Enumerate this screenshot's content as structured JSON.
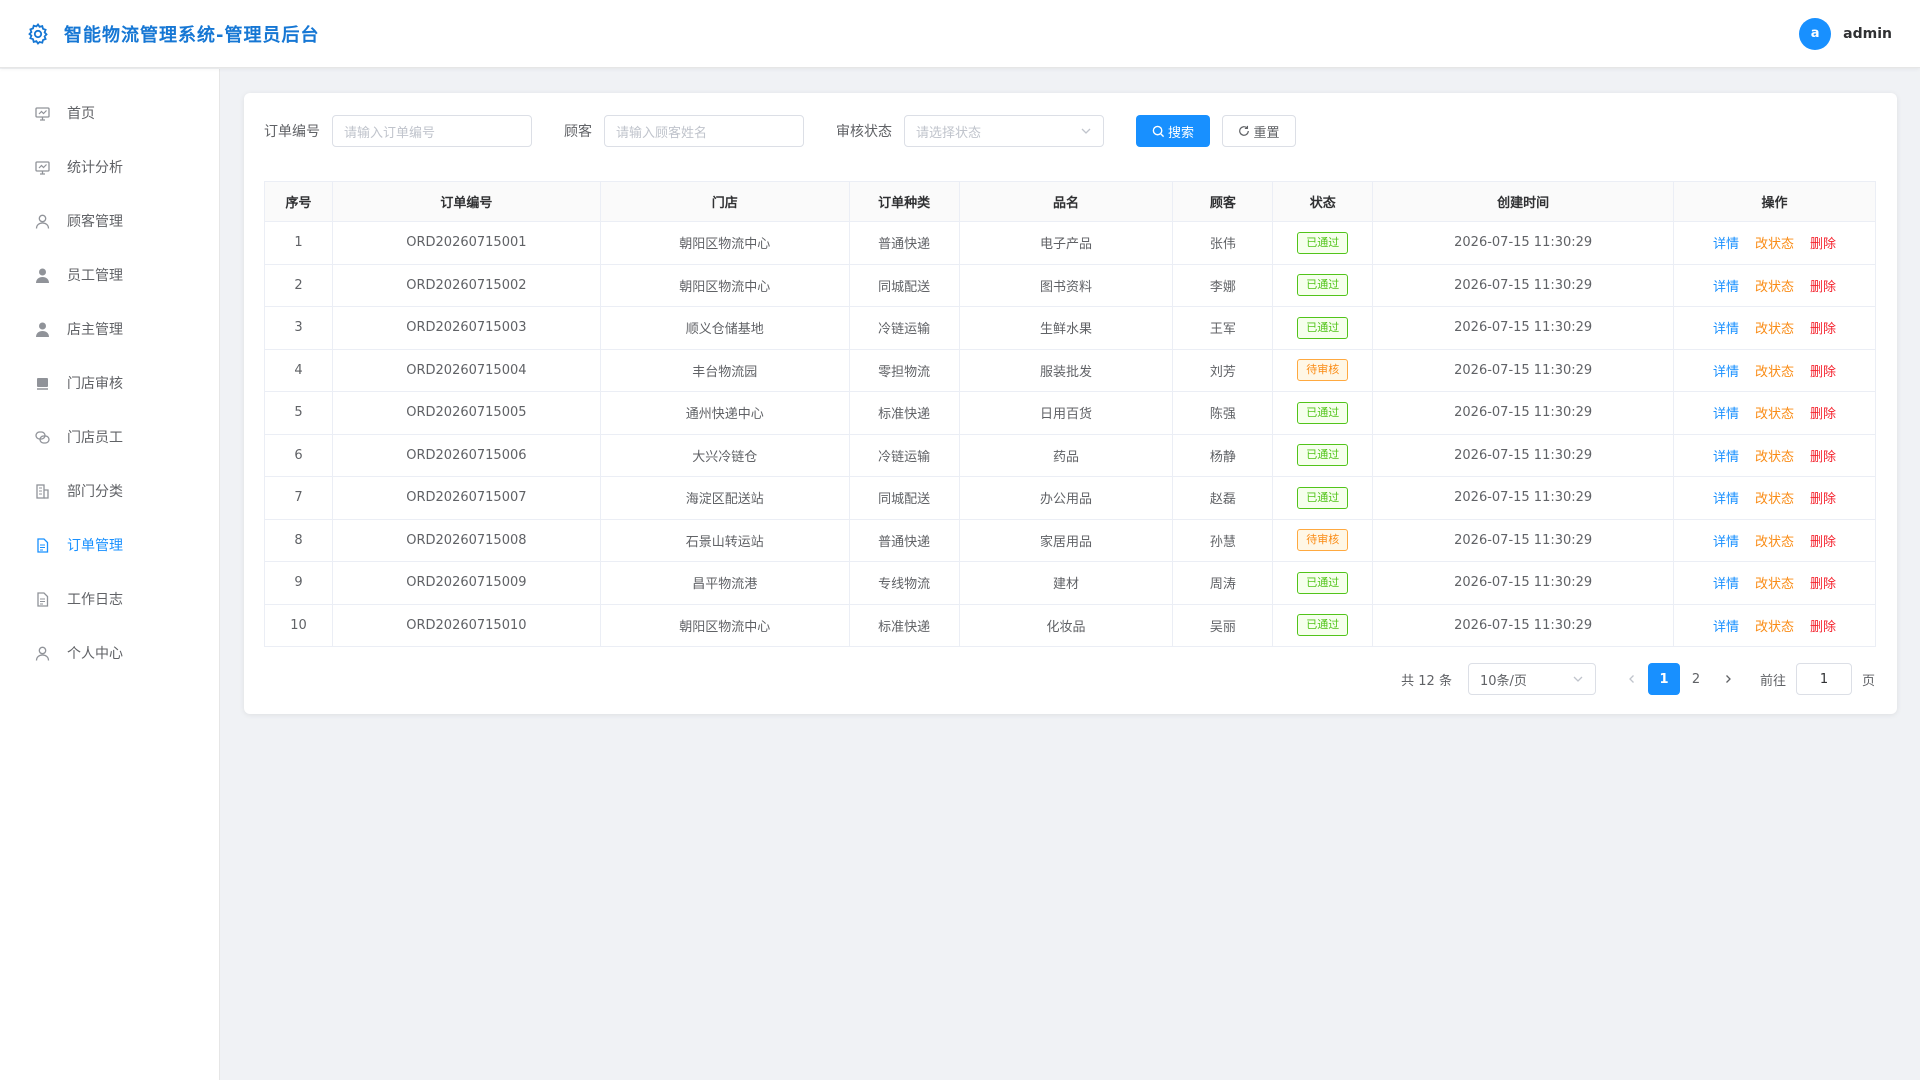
{
  "header": {
    "title": "智能物流管理系统-管理员后台",
    "avatar_letter": "a",
    "username": "admin"
  },
  "sidebar": {
    "items": [
      {
        "label": "首页",
        "icon": "monitor-icon"
      },
      {
        "label": "统计分析",
        "icon": "monitor-icon"
      },
      {
        "label": "顾客管理",
        "icon": "user-outline-icon"
      },
      {
        "label": "员工管理",
        "icon": "user-filled-icon"
      },
      {
        "label": "店主管理",
        "icon": "user-filled-icon"
      },
      {
        "label": "门店审核",
        "icon": "shop-icon"
      },
      {
        "label": "门店员工",
        "icon": "link-icon"
      },
      {
        "label": "部门分类",
        "icon": "building-icon"
      },
      {
        "label": "订单管理",
        "icon": "document-icon",
        "active": true
      },
      {
        "label": "工作日志",
        "icon": "document-icon"
      },
      {
        "label": "个人中心",
        "icon": "user-outline-icon"
      }
    ]
  },
  "search": {
    "order_label": "订单编号",
    "order_placeholder": "请输入订单编号",
    "customer_label": "顾客",
    "customer_placeholder": "请输入顾客姓名",
    "status_label": "审核状态",
    "status_placeholder": "请选择状态",
    "search_btn": "搜索",
    "reset_btn": "重置"
  },
  "table": {
    "headers": [
      "序号",
      "订单编号",
      "门店",
      "订单种类",
      "品名",
      "顾客",
      "状态",
      "创建时间",
      "操作"
    ],
    "rows": [
      [
        "1",
        "ORD20260715001",
        "朝阳区物流中心",
        "普通快递",
        "电子产品",
        "张伟",
        "已通过",
        "2026-07-15 11:30:29"
      ],
      [
        "2",
        "ORD20260715002",
        "朝阳区物流中心",
        "同城配送",
        "图书资料",
        "李娜",
        "已通过",
        "2026-07-15 11:30:29"
      ],
      [
        "3",
        "ORD20260715003",
        "顺义仓储基地",
        "冷链运输",
        "生鲜水果",
        "王军",
        "已通过",
        "2026-07-15 11:30:29"
      ],
      [
        "4",
        "ORD20260715004",
        "丰台物流园",
        "零担物流",
        "服装批发",
        "刘芳",
        "待审核",
        "2026-07-15 11:30:29"
      ],
      [
        "5",
        "ORD20260715005",
        "通州快递中心",
        "标准快递",
        "日用百货",
        "陈强",
        "已通过",
        "2026-07-15 11:30:29"
      ],
      [
        "6",
        "ORD20260715006",
        "大兴冷链仓",
        "冷链运输",
        "药品",
        "杨静",
        "已通过",
        "2026-07-15 11:30:29"
      ],
      [
        "7",
        "ORD20260715007",
        "海淀区配送站",
        "同城配送",
        "办公用品",
        "赵磊",
        "已通过",
        "2026-07-15 11:30:29"
      ],
      [
        "8",
        "ORD20260715008",
        "石景山转运站",
        "普通快递",
        "家居用品",
        "孙慧",
        "待审核",
        "2026-07-15 11:30:29"
      ],
      [
        "9",
        "ORD20260715009",
        "昌平物流港",
        "专线物流",
        "建材",
        "周涛",
        "已通过",
        "2026-07-15 11:30:29"
      ],
      [
        "10",
        "ORD20260715010",
        "朝阳区物流中心",
        "标准快递",
        "化妆品",
        "吴丽",
        "已通过",
        "2026-07-15 11:30:29"
      ]
    ],
    "actions": {
      "detail": "详情",
      "change": "改状态",
      "delete": "删除"
    }
  },
  "pagination": {
    "total": "共 12 条",
    "page_size": "10条/页",
    "pages": [
      "1",
      "2"
    ],
    "current": "1",
    "goto_label": "前往",
    "goto_value": "1",
    "goto_suffix": "页"
  },
  "colors": {
    "primary": "#1890ff",
    "success": "#52c41a",
    "warning": "#fa8c16",
    "danger": "#f5222d"
  }
}
